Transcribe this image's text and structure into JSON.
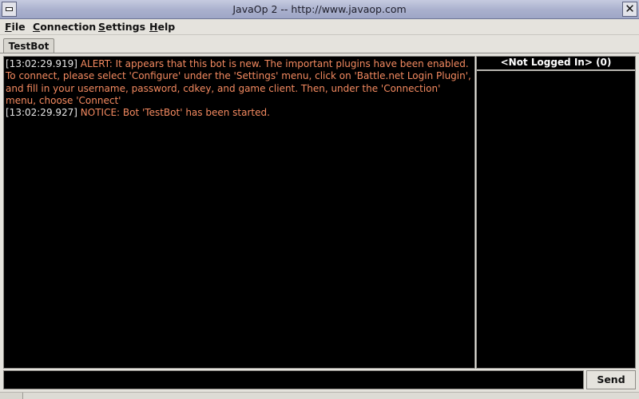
{
  "window": {
    "title": "JavaOp 2 -- http://www.javaop.com"
  },
  "menubar": {
    "items": [
      {
        "label_u": "F",
        "label_rest": "ile"
      },
      {
        "label_u": "C",
        "label_rest": "onnection"
      },
      {
        "label_u": "S",
        "label_rest": "ettings"
      },
      {
        "label_u": "H",
        "label_rest": "elp"
      }
    ]
  },
  "tabs": [
    {
      "label": "TestBot",
      "active": true
    }
  ],
  "chat": {
    "lines": [
      {
        "timestamp": "[13:02:29.919]",
        "text": " ALERT: It appears that this bot is new.  The important plugins have been enabled.  To connect, please select 'Configure' under the 'Settings' menu, click on 'Battle.net Login Plugin', and fill in your username, password, cdkey, and game client.  Then, under the 'Connection' menu, choose 'Connect'"
      },
      {
        "timestamp": "[13:02:29.927]",
        "text": " NOTICE: Bot 'TestBot' has been started."
      }
    ]
  },
  "userlist": {
    "header": "<Not Logged In> (0)"
  },
  "input": {
    "value": ""
  },
  "send_button": {
    "label": "Send"
  },
  "colors": {
    "chat_background": "#000000",
    "timestamp": "#e7e7e7",
    "message": "#f48a60"
  }
}
